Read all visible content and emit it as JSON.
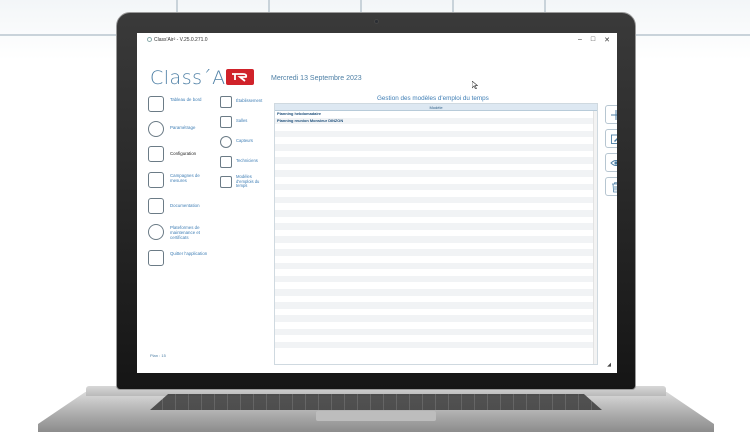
{
  "window": {
    "title": "Class'Air² - V.25.0.271.0",
    "minimize": "–",
    "maximize": "□",
    "close": "✕"
  },
  "brand": {
    "name": "Class´Air",
    "logo_icon": "company-logo-icon"
  },
  "date": "Mercredi 13 Septembre 2023",
  "sidebar": {
    "items": [
      {
        "label": "Tableau de bord",
        "icon": "dashboard-icon"
      },
      {
        "label": "Paramétrage",
        "icon": "gears-icon"
      },
      {
        "label": "Configuration",
        "icon": "building-icon"
      },
      {
        "label": "Campagnes de mesures",
        "icon": "measure-campaign-icon"
      },
      {
        "label": "Documentation",
        "icon": "document-icon"
      },
      {
        "label": "Plateformes de maintenance et certificats",
        "icon": "globe-icon"
      },
      {
        "label": "Quitter l'application",
        "icon": "exit-icon"
      }
    ],
    "footer": "Plan : 15"
  },
  "midnav": {
    "items": [
      {
        "label": "Établissement",
        "icon": "building-small-icon"
      },
      {
        "label": "Salles",
        "icon": "house-icon"
      },
      {
        "label": "Capteurs",
        "icon": "sensor-icon"
      },
      {
        "label": "Techniciens",
        "icon": "technician-icon"
      },
      {
        "label": "Modèles d'emplois du temps",
        "icon": "calendar-icon"
      }
    ]
  },
  "panel": {
    "title": "Gestion des modèles d'emploi du temps",
    "column_header": "Modèle",
    "rows": [
      "Planning hebdomadaire",
      "Planning reunion Monsieur DINZON"
    ],
    "buttons": [
      {
        "name": "add",
        "icon": "plus-icon"
      },
      {
        "name": "edit",
        "icon": "edit-icon"
      },
      {
        "name": "view",
        "icon": "eye-icon"
      },
      {
        "name": "delete",
        "icon": "trash-icon"
      }
    ]
  },
  "colors": {
    "accent": "#3f7eb5",
    "logo": "#d0222a",
    "header": "#dde8f2"
  }
}
